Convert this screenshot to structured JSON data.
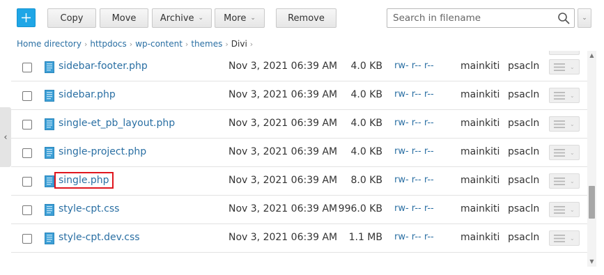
{
  "toolbar": {
    "add_label": "+",
    "copy_label": "Copy",
    "move_label": "Move",
    "archive_label": "Archive",
    "more_label": "More",
    "remove_label": "Remove",
    "dropdown_caret": "⌄"
  },
  "search": {
    "placeholder": "Search in filename"
  },
  "breadcrumb": {
    "items": [
      "Home directory",
      "httpdocs",
      "wp-content",
      "themes",
      "Divi"
    ],
    "separator": "›"
  },
  "side_panel_toggle": "‹",
  "files": [
    {
      "name": "sidebar-footer.php",
      "modified": "Nov 3, 2021 06:39 AM",
      "size": "4.0 KB",
      "permissions": "rw- r-- r--",
      "user": "mainkiti",
      "group": "psacln",
      "highlighted": false
    },
    {
      "name": "sidebar.php",
      "modified": "Nov 3, 2021 06:39 AM",
      "size": "4.0 KB",
      "permissions": "rw- r-- r--",
      "user": "mainkiti",
      "group": "psacln",
      "highlighted": false
    },
    {
      "name": "single-et_pb_layout.php",
      "modified": "Nov 3, 2021 06:39 AM",
      "size": "4.0 KB",
      "permissions": "rw- r-- r--",
      "user": "mainkiti",
      "group": "psacln",
      "highlighted": false
    },
    {
      "name": "single-project.php",
      "modified": "Nov 3, 2021 06:39 AM",
      "size": "4.0 KB",
      "permissions": "rw- r-- r--",
      "user": "mainkiti",
      "group": "psacln",
      "highlighted": false
    },
    {
      "name": "single.php",
      "modified": "Nov 3, 2021 06:39 AM",
      "size": "8.0 KB",
      "permissions": "rw- r-- r--",
      "user": "mainkiti",
      "group": "psacln",
      "highlighted": true
    },
    {
      "name": "style-cpt.css",
      "modified": "Nov 3, 2021 06:39 AM",
      "size": "996.0 KB",
      "permissions": "rw- r-- r--",
      "user": "mainkiti",
      "group": "psacln",
      "highlighted": false
    },
    {
      "name": "style-cpt.dev.css",
      "modified": "Nov 3, 2021 06:39 AM",
      "size": "1.1 MB",
      "permissions": "rw- r-- r--",
      "user": "mainkiti",
      "group": "psacln",
      "highlighted": false
    }
  ],
  "icons": {
    "add": "plus-icon",
    "search": "magnifier-icon",
    "file": "file-icon",
    "row_menu": "hamburger-icon"
  },
  "colors": {
    "accent": "#1fa6e6",
    "link": "#2a6fa3",
    "highlight": "#e0161e"
  }
}
